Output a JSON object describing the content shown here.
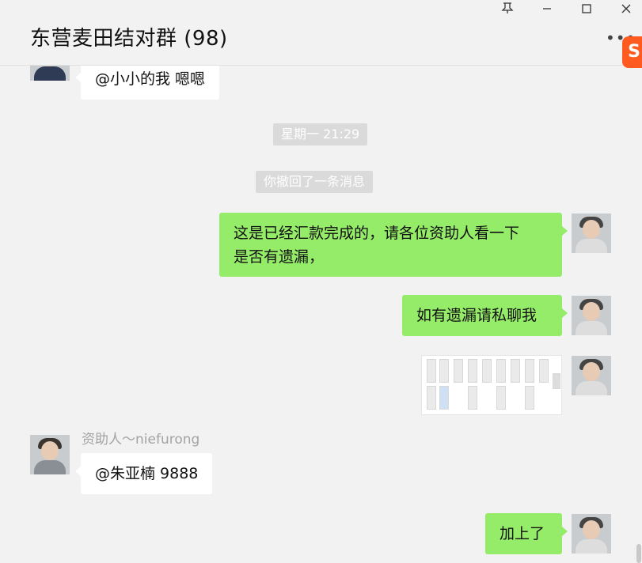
{
  "window": {
    "title": "东营麦田结对群 (98)",
    "pin_icon": "pin-icon",
    "minimize_icon": "minimize-icon",
    "maximize_icon": "maximize-icon",
    "close_icon": "close-icon",
    "more_icon": "more-icon",
    "ime_logo": "S"
  },
  "messages": {
    "m1": {
      "text": "@小小的我 嗯嗯",
      "direction": "in"
    },
    "time_sep": "星期一 21:29",
    "recall_notice": "你撤回了一条消息",
    "m2": {
      "lines": [
        "这是已经汇款完成的，请各位资助人看一下",
        "是否有遗漏，"
      ],
      "direction": "out"
    },
    "m3": {
      "text": "如有遗漏请私聊我",
      "direction": "out"
    },
    "m4": {
      "type": "image",
      "direction": "out"
    },
    "m5": {
      "sender": "资助人～niefurong",
      "text": "@朱亚楠 9888",
      "direction": "in"
    },
    "m6": {
      "text": "加上了",
      "direction": "out"
    }
  },
  "colors": {
    "out_bubble": "#95ec69",
    "in_bubble": "#ffffff",
    "background": "#f2f2f2",
    "ime": "#ff5a1f"
  }
}
